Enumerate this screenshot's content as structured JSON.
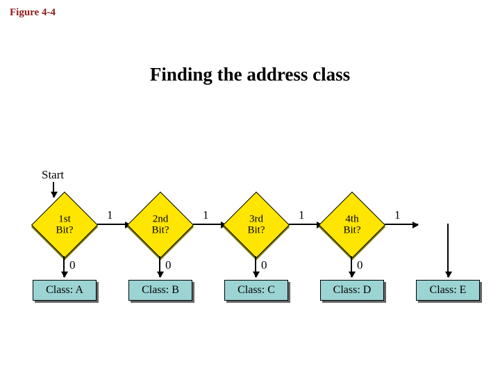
{
  "figure_label": "Figure 4-4",
  "title": "Finding the address class",
  "start": "Start",
  "edge_one": "1",
  "edge_zero": "0",
  "decisions": [
    {
      "label": "1st\nBit?"
    },
    {
      "label": "2nd\nBit?"
    },
    {
      "label": "3rd\nBit?"
    },
    {
      "label": "4th\nBit?"
    }
  ],
  "classes": [
    {
      "label": "Class: A"
    },
    {
      "label": "Class: B"
    },
    {
      "label": "Class: C"
    },
    {
      "label": "Class: D"
    },
    {
      "label": "Class: E"
    }
  ]
}
